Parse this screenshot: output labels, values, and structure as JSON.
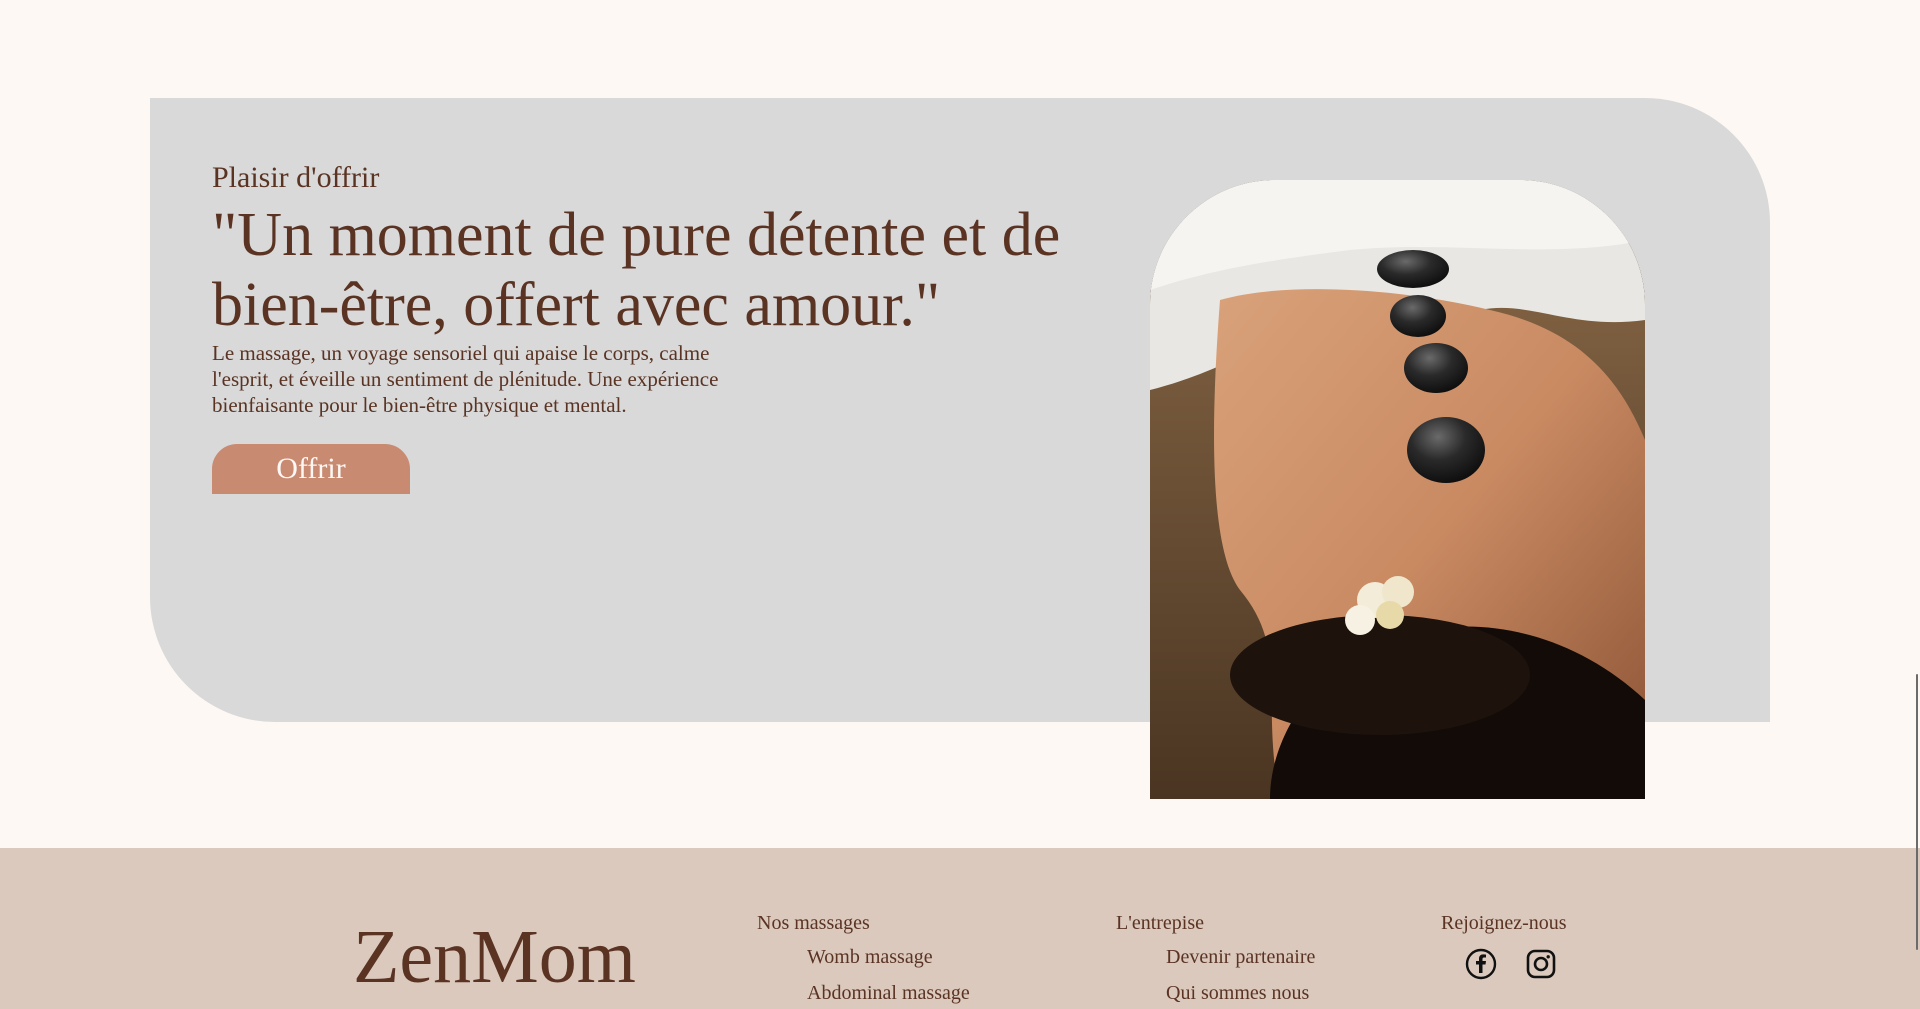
{
  "hero": {
    "eyebrow": "Plaisir d'offrir",
    "headline_line1": "\"Un moment de pure détente et de",
    "headline_line2": "bien-être, offert avec amour.\"",
    "description": "Le massage, un voyage sensoriel qui apaise le corps, calme l'esprit, et éveille un sentiment de plénitude. Une expérience bienfaisante pour le bien-être physique et mental.",
    "button_label": "Offrir"
  },
  "footer": {
    "brand": "ZenMom",
    "columns": [
      {
        "title": "Nos massages",
        "links": [
          "Womb massage",
          "Abdominal massage"
        ]
      },
      {
        "title": "L'entrepise",
        "links": [
          "Devenir partenaire",
          "Qui sommes nous"
        ]
      }
    ],
    "social": {
      "title": "Rejoignez-nous",
      "icons": [
        "facebook-icon",
        "instagram-icon"
      ]
    }
  },
  "colors": {
    "page_background": "#fdf8f4",
    "card_background": "#d9d9d9",
    "text_brown": "#5a3323",
    "button_terracotta": "#c98a72",
    "footer_background": "#dbc9bd"
  }
}
